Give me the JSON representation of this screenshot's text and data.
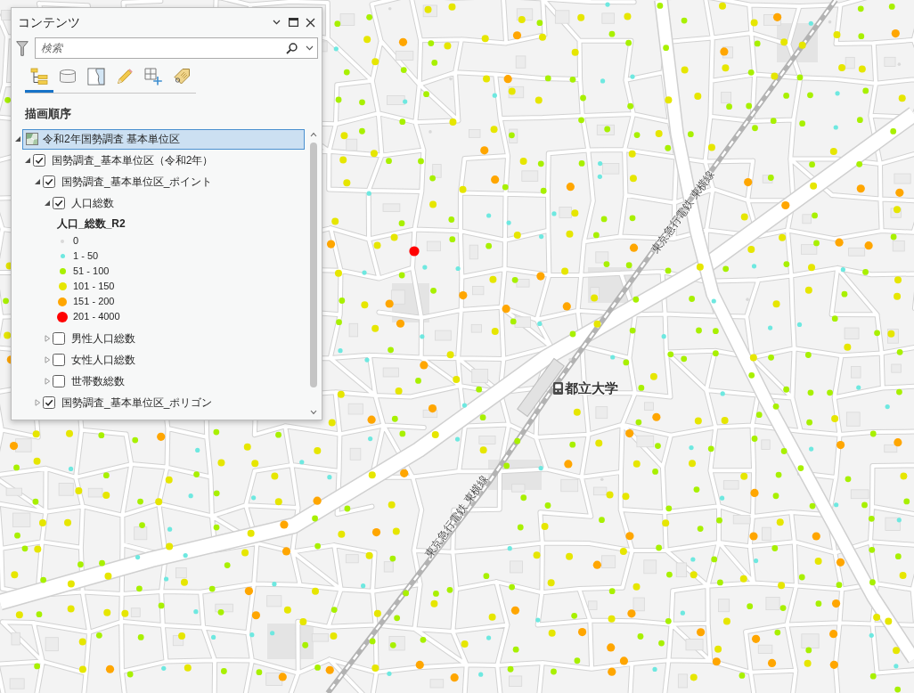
{
  "panel": {
    "title": "コンテンツ",
    "search": {
      "placeholder": "検索"
    },
    "view_tabs": [
      {
        "kind": "order",
        "selected": true
      },
      {
        "kind": "source",
        "selected": false
      },
      {
        "kind": "selection",
        "selected": false
      },
      {
        "kind": "edit",
        "selected": false
      },
      {
        "kind": "snapping",
        "selected": false
      },
      {
        "kind": "label",
        "selected": false
      }
    ],
    "heading": "描画順序",
    "tree": [
      {
        "kind": "map",
        "label": "令和2年国勢調査 基本単位区",
        "selected": true,
        "expanded": true,
        "children": [
          {
            "kind": "layer",
            "label": "国勢調査_基本単位区（令和2年）",
            "checked": true,
            "expanded": true,
            "selected": false,
            "children": [
              {
                "kind": "layer",
                "label": "国勢調査_基本単位区_ポイント",
                "checked": true,
                "expanded": true,
                "selected": false,
                "children": [
                  {
                    "kind": "layer",
                    "label": "人口総数",
                    "checked": true,
                    "expanded": true,
                    "selected": false,
                    "legend": {
                      "title": "人口_総数_R2",
                      "classes": [
                        {
                          "label": "0",
                          "color": "#d9d9d9"
                        },
                        {
                          "label": "1 - 50",
                          "color": "#6ee8e0"
                        },
                        {
                          "label": "51 - 100",
                          "color": "#a8f000"
                        },
                        {
                          "label": "101 - 150",
                          "color": "#e6e600"
                        },
                        {
                          "label": "151 - 200",
                          "color": "#ffa600"
                        },
                        {
                          "label": "201 - 4000",
                          "color": "#ff0000"
                        }
                      ]
                    }
                  },
                  {
                    "kind": "layer",
                    "label": "男性人口総数",
                    "checked": false,
                    "expanded": false,
                    "selected": false
                  },
                  {
                    "kind": "layer",
                    "label": "女性人口総数",
                    "checked": false,
                    "expanded": false,
                    "selected": false
                  },
                  {
                    "kind": "layer",
                    "label": "世帯数総数",
                    "checked": false,
                    "expanded": false,
                    "selected": false
                  }
                ]
              },
              {
                "kind": "layer",
                "label": "国勢調査_基本単位区_ポリゴン",
                "checked": true,
                "expanded": false,
                "selected": false
              }
            ]
          }
        ]
      }
    ]
  },
  "map": {
    "labels": [
      {
        "kind": "station",
        "text": "都立大学"
      },
      {
        "kind": "railway",
        "text": "東京急行電鉄 東横線"
      },
      {
        "kind": "railway",
        "text": "東京急行電鉄 東横線"
      }
    ]
  }
}
